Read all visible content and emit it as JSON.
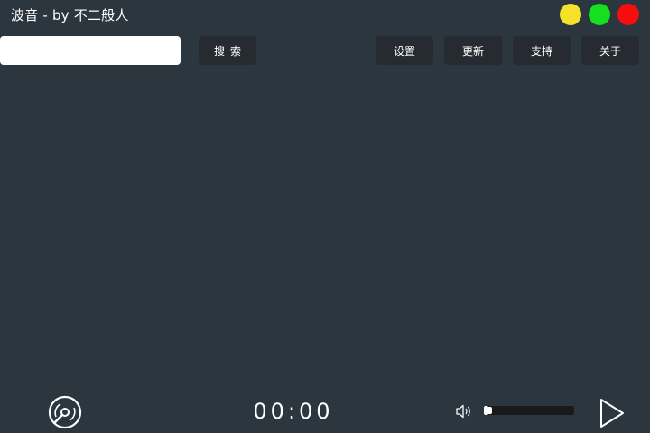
{
  "window": {
    "title": "波音 - by 不二般人",
    "controls": {
      "minimize_color": "#f5e12a",
      "maximize_color": "#16e01d",
      "close_color": "#f70d0d"
    }
  },
  "toolbar": {
    "search_placeholder": "",
    "search_value": "",
    "search_label": "搜索",
    "settings_label": "设置",
    "update_label": "更新",
    "support_label": "支持",
    "about_label": "关于"
  },
  "player": {
    "time": "00:00",
    "volume_fraction": 0.05,
    "icons": {
      "disc": "disc-icon",
      "volume": "volume-icon",
      "play": "play-icon"
    }
  },
  "theme": {
    "background": "#2b363f",
    "button_bg": "#252b30",
    "text": "#ffffff"
  }
}
